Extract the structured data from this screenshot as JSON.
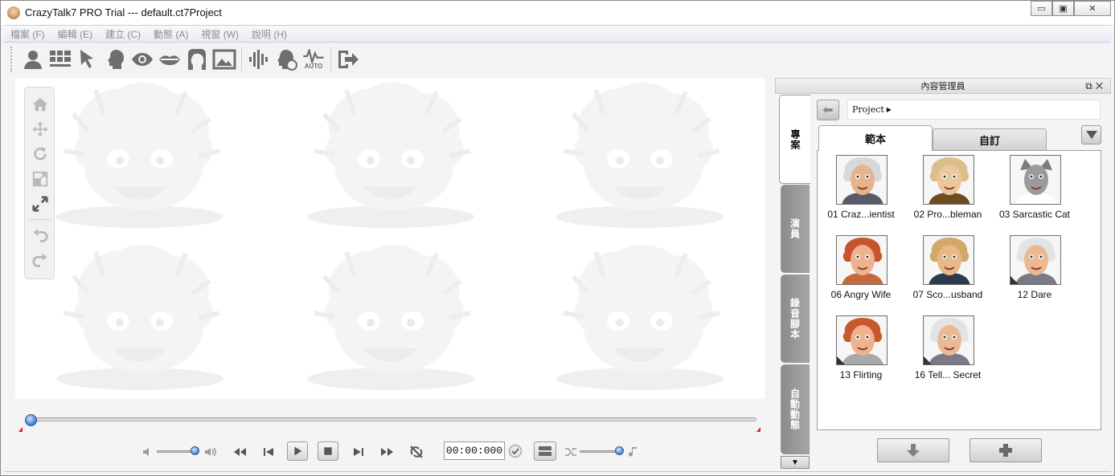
{
  "window": {
    "title": "CrazyTalk7 PRO Trial --- default.ct7Project",
    "app_icon": "crazytalk-logo-icon"
  },
  "menu": [
    "檔案 (F)",
    "編輯 (E)",
    "建立 (C)",
    "動態 (A)",
    "視窗 (W)",
    "說明 (H)"
  ],
  "toolbar": {
    "icons": [
      "actor-icon",
      "layout-icon",
      "pointer-icon",
      "head-icon",
      "eye-icon",
      "mouth-icon",
      "face-profile-icon",
      "image-icon",
      "voice-wave-icon",
      "face-sound-icon",
      "auto-motion-icon",
      "exit-icon"
    ],
    "auto_label": "AUTO"
  },
  "side_tools": [
    "home-icon",
    "move-icon",
    "rotate-icon",
    "scale-icon",
    "fit-icon",
    "undo-icon",
    "redo-icon"
  ],
  "transport": {
    "time": "00:00:000",
    "volume_level": 0.9,
    "speed_level": 0.9,
    "timeline_position": 0.0
  },
  "content_manager": {
    "title": "內容管理員",
    "side_tabs": [
      "專案",
      "演員",
      "錄音腳本",
      "自動動態"
    ],
    "path": "Project",
    "tabs": [
      "範本",
      "自訂"
    ],
    "items": [
      {
        "label": "01 Craz...ientist",
        "kind": "scientist",
        "badge": false
      },
      {
        "label": "02 Pro...bleman",
        "kind": "nobleman",
        "badge": false
      },
      {
        "label": "03 Sarcastic Cat",
        "kind": "cat",
        "badge": false
      },
      {
        "label": "06 Angry Wife",
        "kind": "wife",
        "badge": false
      },
      {
        "label": "07 Sco...usband",
        "kind": "husband",
        "badge": false
      },
      {
        "label": "12 Dare",
        "kind": "einstein",
        "badge": true
      },
      {
        "label": "13 Flirting",
        "kind": "flirt",
        "badge": true
      },
      {
        "label": "16 Tell... Secret",
        "kind": "einstein",
        "badge": true
      }
    ]
  }
}
